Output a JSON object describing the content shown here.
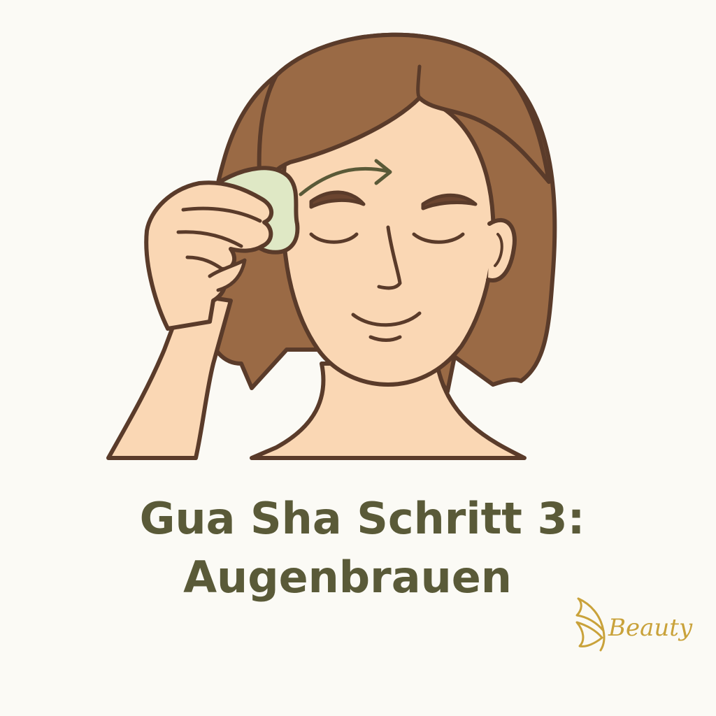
{
  "title": {
    "line1": "Gua Sha Schritt 3:",
    "line2": "Augenbrauen"
  },
  "logo": {
    "text": "Beauty",
    "icon": "butterfly-icon",
    "color": "#c9a23a"
  },
  "colors": {
    "background": "#fbfaf5",
    "hair": "#9a6a45",
    "skin": "#fad7b4",
    "outline": "#5a3b2a",
    "gua_sha_stone": "#dfe8c5",
    "arrow": "#5a5a38",
    "title": "#5a5a38"
  }
}
